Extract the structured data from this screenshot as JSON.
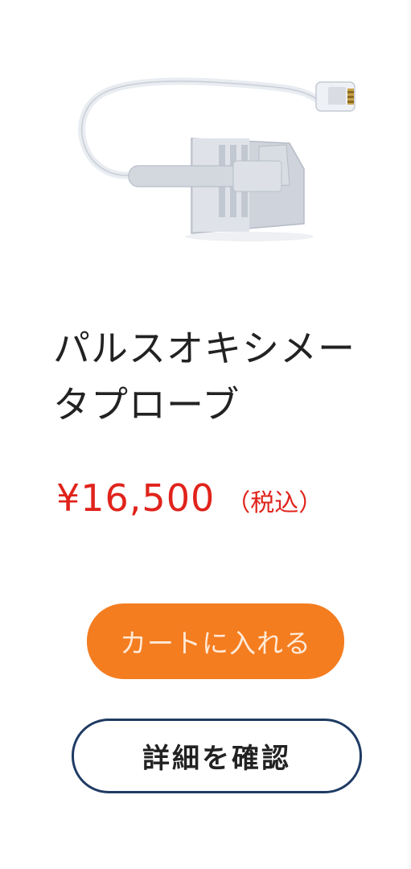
{
  "product": {
    "image_alt": "pulse-oximeter-probe",
    "title_line1": "パルスオキシメー",
    "title_line2": "タプローブ",
    "price": "¥16,500",
    "tax_note": "（税込）"
  },
  "actions": {
    "add_to_cart_label": "カートに入れる",
    "view_details_label": "詳細を確認"
  },
  "colors": {
    "price": "#e0231b",
    "cart_button": "#f47d20",
    "detail_border": "#1f3b63"
  }
}
